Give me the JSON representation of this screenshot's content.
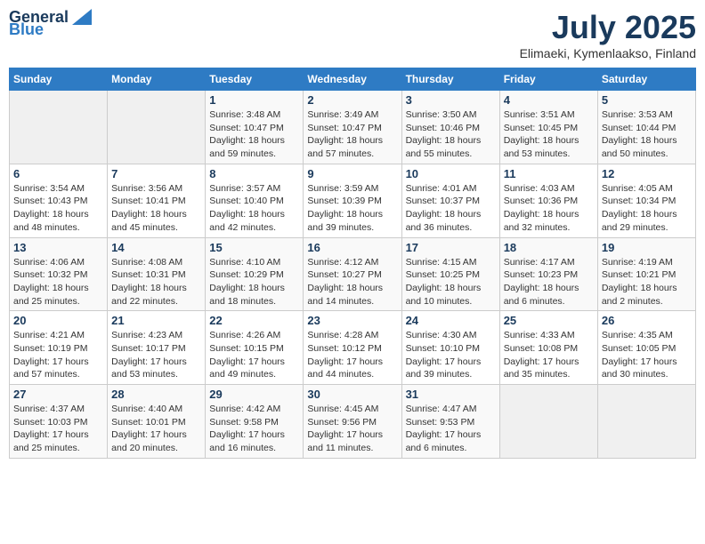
{
  "logo": {
    "general": "General",
    "blue": "Blue"
  },
  "title": {
    "month": "July 2025",
    "location": "Elimaeki, Kymenlaakso, Finland"
  },
  "days_of_week": [
    "Sunday",
    "Monday",
    "Tuesday",
    "Wednesday",
    "Thursday",
    "Friday",
    "Saturday"
  ],
  "weeks": [
    [
      {
        "day": "",
        "info": ""
      },
      {
        "day": "",
        "info": ""
      },
      {
        "day": "1",
        "info": "Sunrise: 3:48 AM\nSunset: 10:47 PM\nDaylight: 18 hours and 59 minutes."
      },
      {
        "day": "2",
        "info": "Sunrise: 3:49 AM\nSunset: 10:47 PM\nDaylight: 18 hours and 57 minutes."
      },
      {
        "day": "3",
        "info": "Sunrise: 3:50 AM\nSunset: 10:46 PM\nDaylight: 18 hours and 55 minutes."
      },
      {
        "day": "4",
        "info": "Sunrise: 3:51 AM\nSunset: 10:45 PM\nDaylight: 18 hours and 53 minutes."
      },
      {
        "day": "5",
        "info": "Sunrise: 3:53 AM\nSunset: 10:44 PM\nDaylight: 18 hours and 50 minutes."
      }
    ],
    [
      {
        "day": "6",
        "info": "Sunrise: 3:54 AM\nSunset: 10:43 PM\nDaylight: 18 hours and 48 minutes."
      },
      {
        "day": "7",
        "info": "Sunrise: 3:56 AM\nSunset: 10:41 PM\nDaylight: 18 hours and 45 minutes."
      },
      {
        "day": "8",
        "info": "Sunrise: 3:57 AM\nSunset: 10:40 PM\nDaylight: 18 hours and 42 minutes."
      },
      {
        "day": "9",
        "info": "Sunrise: 3:59 AM\nSunset: 10:39 PM\nDaylight: 18 hours and 39 minutes."
      },
      {
        "day": "10",
        "info": "Sunrise: 4:01 AM\nSunset: 10:37 PM\nDaylight: 18 hours and 36 minutes."
      },
      {
        "day": "11",
        "info": "Sunrise: 4:03 AM\nSunset: 10:36 PM\nDaylight: 18 hours and 32 minutes."
      },
      {
        "day": "12",
        "info": "Sunrise: 4:05 AM\nSunset: 10:34 PM\nDaylight: 18 hours and 29 minutes."
      }
    ],
    [
      {
        "day": "13",
        "info": "Sunrise: 4:06 AM\nSunset: 10:32 PM\nDaylight: 18 hours and 25 minutes."
      },
      {
        "day": "14",
        "info": "Sunrise: 4:08 AM\nSunset: 10:31 PM\nDaylight: 18 hours and 22 minutes."
      },
      {
        "day": "15",
        "info": "Sunrise: 4:10 AM\nSunset: 10:29 PM\nDaylight: 18 hours and 18 minutes."
      },
      {
        "day": "16",
        "info": "Sunrise: 4:12 AM\nSunset: 10:27 PM\nDaylight: 18 hours and 14 minutes."
      },
      {
        "day": "17",
        "info": "Sunrise: 4:15 AM\nSunset: 10:25 PM\nDaylight: 18 hours and 10 minutes."
      },
      {
        "day": "18",
        "info": "Sunrise: 4:17 AM\nSunset: 10:23 PM\nDaylight: 18 hours and 6 minutes."
      },
      {
        "day": "19",
        "info": "Sunrise: 4:19 AM\nSunset: 10:21 PM\nDaylight: 18 hours and 2 minutes."
      }
    ],
    [
      {
        "day": "20",
        "info": "Sunrise: 4:21 AM\nSunset: 10:19 PM\nDaylight: 17 hours and 57 minutes."
      },
      {
        "day": "21",
        "info": "Sunrise: 4:23 AM\nSunset: 10:17 PM\nDaylight: 17 hours and 53 minutes."
      },
      {
        "day": "22",
        "info": "Sunrise: 4:26 AM\nSunset: 10:15 PM\nDaylight: 17 hours and 49 minutes."
      },
      {
        "day": "23",
        "info": "Sunrise: 4:28 AM\nSunset: 10:12 PM\nDaylight: 17 hours and 44 minutes."
      },
      {
        "day": "24",
        "info": "Sunrise: 4:30 AM\nSunset: 10:10 PM\nDaylight: 17 hours and 39 minutes."
      },
      {
        "day": "25",
        "info": "Sunrise: 4:33 AM\nSunset: 10:08 PM\nDaylight: 17 hours and 35 minutes."
      },
      {
        "day": "26",
        "info": "Sunrise: 4:35 AM\nSunset: 10:05 PM\nDaylight: 17 hours and 30 minutes."
      }
    ],
    [
      {
        "day": "27",
        "info": "Sunrise: 4:37 AM\nSunset: 10:03 PM\nDaylight: 17 hours and 25 minutes."
      },
      {
        "day": "28",
        "info": "Sunrise: 4:40 AM\nSunset: 10:01 PM\nDaylight: 17 hours and 20 minutes."
      },
      {
        "day": "29",
        "info": "Sunrise: 4:42 AM\nSunset: 9:58 PM\nDaylight: 17 hours and 16 minutes."
      },
      {
        "day": "30",
        "info": "Sunrise: 4:45 AM\nSunset: 9:56 PM\nDaylight: 17 hours and 11 minutes."
      },
      {
        "day": "31",
        "info": "Sunrise: 4:47 AM\nSunset: 9:53 PM\nDaylight: 17 hours and 6 minutes."
      },
      {
        "day": "",
        "info": ""
      },
      {
        "day": "",
        "info": ""
      }
    ]
  ]
}
